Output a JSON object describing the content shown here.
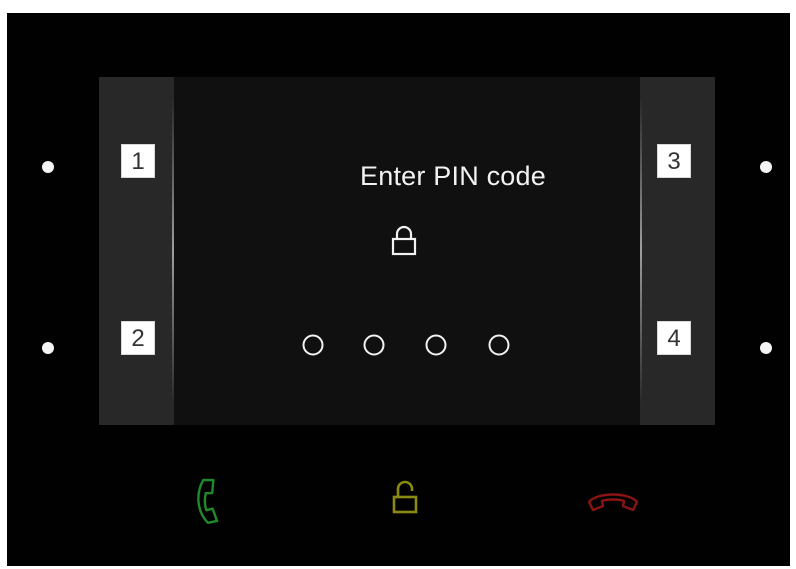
{
  "screen": {
    "title": "Enter PIN code",
    "icon": "lock-closed-icon",
    "pin_length": 4,
    "pin_entered": 0
  },
  "soft_keys": {
    "key1": "1",
    "key2": "2",
    "key3": "3",
    "key4": "4"
  },
  "hardware_buttons": [
    {
      "name": "call-answer-button",
      "icon": "phone-answer-icon",
      "color": "#1f8a2b"
    },
    {
      "name": "door-unlock-button",
      "icon": "lock-open-icon",
      "color": "#8a8a12"
    },
    {
      "name": "call-hangup-button",
      "icon": "phone-hangup-icon",
      "color": "#8a1414"
    }
  ],
  "colors": {
    "device_bezel": "#010101",
    "screen_background": "#101010",
    "side_panel": "#282828",
    "text": "#f2f2f2"
  }
}
